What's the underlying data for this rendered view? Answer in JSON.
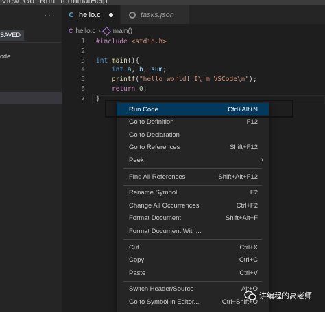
{
  "menubar": {
    "items": [
      "View",
      "Go",
      "Run",
      "Terminal",
      "Help"
    ]
  },
  "sidebar": {
    "actions_glyph": "···",
    "saved_label": "SAVED",
    "item_partial": "ode"
  },
  "tabs": [
    {
      "label": "hello.c",
      "icon": "c-file-icon",
      "modified": true
    },
    {
      "label": "tasks.json",
      "icon": "json-file-icon"
    }
  ],
  "breadcrumb": {
    "file": "hello.c",
    "symbol": "main()"
  },
  "editor": {
    "line_numbers": [
      "1",
      "2",
      "3",
      "4",
      "5",
      "6",
      "7"
    ],
    "lines": [
      {
        "parts": [
          [
            "pp",
            "#include "
          ],
          [
            "inc",
            "<stdio.h>"
          ]
        ]
      },
      {
        "parts": []
      },
      {
        "parts": [
          [
            "kw",
            "int"
          ],
          [
            "pl",
            " "
          ],
          [
            "fn",
            "main"
          ],
          [
            "pl",
            "(){"
          ]
        ]
      },
      {
        "parts": [
          [
            "pl",
            "    "
          ],
          [
            "kw",
            "int"
          ],
          [
            "pl",
            " "
          ],
          [
            "id",
            "a"
          ],
          [
            "pl",
            ", "
          ],
          [
            "id",
            "b"
          ],
          [
            "pl",
            ", "
          ],
          [
            "id",
            "sum"
          ],
          [
            "pl",
            ";"
          ]
        ]
      },
      {
        "parts": [
          [
            "pl",
            "    "
          ],
          [
            "fn",
            "printf"
          ],
          [
            "pl",
            "("
          ],
          [
            "str",
            "\"hello world! I\\'m VSCode\\n\""
          ],
          [
            "pl",
            ");"
          ]
        ]
      },
      {
        "parts": [
          [
            "pl",
            "    "
          ],
          [
            "pp",
            "return"
          ],
          [
            "pl",
            " "
          ],
          [
            "num",
            "0"
          ],
          [
            "pl",
            ";"
          ]
        ]
      },
      {
        "parts": [
          [
            "pl",
            "}"
          ]
        ]
      }
    ]
  },
  "context_menu": {
    "groups": [
      [
        {
          "label": "Run Code",
          "shortcut": "Ctrl+Alt+N",
          "highlighted": true
        },
        {
          "label": "Go to Definition",
          "shortcut": "F12"
        },
        {
          "label": "Go to Declaration",
          "shortcut": ""
        },
        {
          "label": "Go to References",
          "shortcut": "Shift+F12"
        },
        {
          "label": "Peek",
          "shortcut": "",
          "submenu": true
        }
      ],
      [
        {
          "label": "Find All References",
          "shortcut": "Shift+Alt+F12"
        }
      ],
      [
        {
          "label": "Rename Symbol",
          "shortcut": "F2"
        },
        {
          "label": "Change All Occurrences",
          "shortcut": "Ctrl+F2"
        },
        {
          "label": "Format Document",
          "shortcut": "Shift+Alt+F"
        },
        {
          "label": "Format Document With...",
          "shortcut": ""
        }
      ],
      [
        {
          "label": "Cut",
          "shortcut": "Ctrl+X"
        },
        {
          "label": "Copy",
          "shortcut": "Ctrl+C"
        },
        {
          "label": "Paste",
          "shortcut": "Ctrl+V"
        }
      ],
      [
        {
          "label": "Switch Header/Source",
          "shortcut": "Alt+O"
        },
        {
          "label": "Go to Symbol in Editor...",
          "shortcut": "Ctrl+Shift+O"
        }
      ]
    ]
  },
  "watermark": {
    "text": "讲编程的高老师"
  },
  "colors": {
    "accent_highlight": "#04395e",
    "editor_bg": "#1e1e1e",
    "menu_bg": "#252526"
  }
}
